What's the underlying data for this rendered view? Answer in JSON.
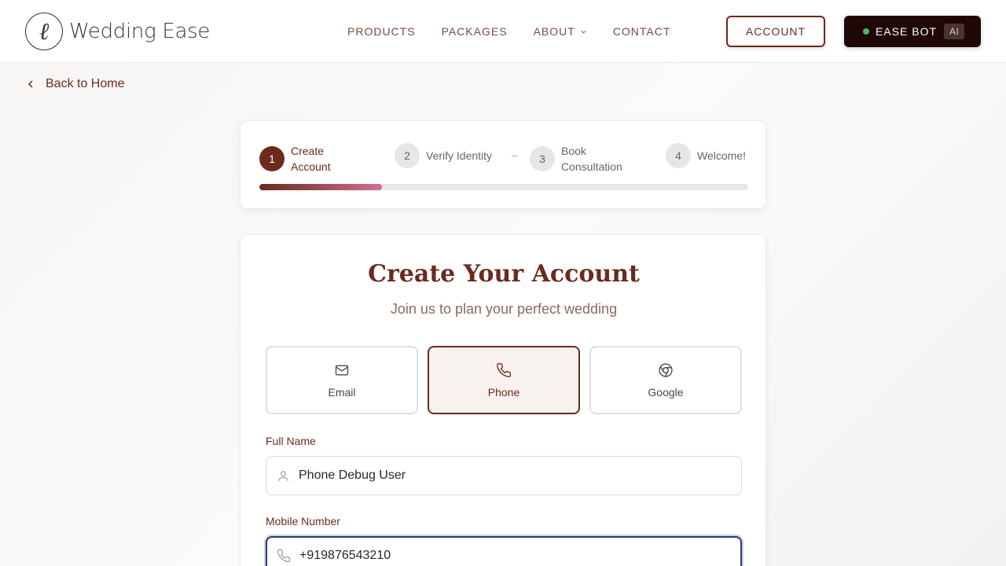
{
  "brand": {
    "logo_mark": "ℓ",
    "name": "Wedding Ease"
  },
  "nav": {
    "items": [
      {
        "label": "PRODUCTS"
      },
      {
        "label": "PACKAGES"
      },
      {
        "label": "ABOUT"
      },
      {
        "label": "CONTACT"
      }
    ],
    "account_label": "ACCOUNT",
    "bot_label": "EASE BOT",
    "bot_badge": "AI"
  },
  "back_link": "Back to Home",
  "stepper": {
    "steps": [
      {
        "num": "1",
        "label": "Create Account",
        "active": true
      },
      {
        "num": "2",
        "label": "Verify Identity",
        "active": false
      },
      {
        "num": "3",
        "label": "Book Consultation",
        "active": false
      },
      {
        "num": "4",
        "label": "Welcome!",
        "active": false
      }
    ],
    "progress": 0.25
  },
  "form": {
    "title": "Create Your Account",
    "subtitle": "Join us to plan your perfect wedding",
    "methods": [
      {
        "label": "Email",
        "icon": "mail-icon"
      },
      {
        "label": "Phone",
        "icon": "phone-icon",
        "selected": true
      },
      {
        "label": "Google",
        "icon": "chrome-icon"
      }
    ],
    "full_name_label": "Full Name",
    "full_name_value": "Phone Debug User",
    "mobile_label": "Mobile Number",
    "mobile_value": "+919876543210"
  },
  "colors": {
    "accent": "#6b2a1d",
    "bot_bg": "#1e0705",
    "online_dot": "#3fbf5a",
    "progress_end": "#d07090"
  }
}
